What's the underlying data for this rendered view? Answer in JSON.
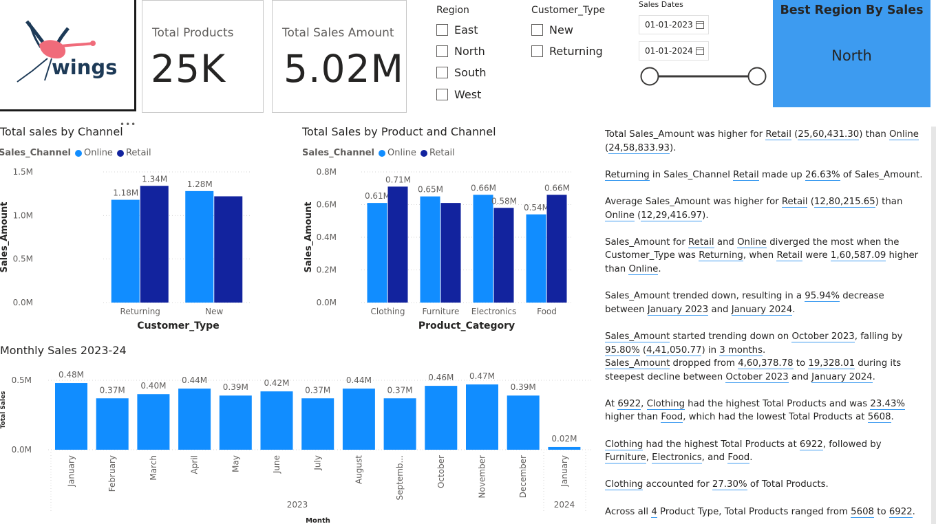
{
  "logo": {
    "text": "wings"
  },
  "cards": [
    {
      "label": "Total Products",
      "value": "25K"
    },
    {
      "label": "Total Sales Amount",
      "value": "5.02M"
    }
  ],
  "region_slicer": {
    "title": "Region",
    "options": [
      "East",
      "North",
      "South",
      "West"
    ]
  },
  "customer_slicer": {
    "title": "Customer_Type",
    "options": [
      "New",
      "Returning"
    ]
  },
  "date_slicer": {
    "title": "Sales Dates",
    "start": "01-01-2023",
    "end": "01-01-2024"
  },
  "best_region": {
    "title": "Best Region By Sales",
    "value": "North"
  },
  "colors": {
    "online": "#118dff",
    "retail": "#12239e",
    "best_bg": "#3d9bf0"
  },
  "chart_by_channel": {
    "title": "Total sales by Channel",
    "legend_title": "Sales_Channel",
    "xlabel": "Customer_Type",
    "ylabel": "Sales_Amount",
    "more_icon": "•••"
  },
  "chart_by_product": {
    "title": "Total Sales by Product and Channel",
    "legend_title": "Sales_Channel",
    "xlabel": "Product_Category",
    "ylabel": "Sales_Amount"
  },
  "chart_monthly": {
    "title": "Monthly Sales 2023-24",
    "xlabel": "Month",
    "ylabel": "Total Sales",
    "year_labels": [
      "2023",
      "2024"
    ]
  },
  "chart_data": [
    {
      "type": "bar",
      "title": "Total sales by Channel",
      "categories": [
        "Returning",
        "New"
      ],
      "series": [
        {
          "name": "Online",
          "values": [
            1180000,
            1280000
          ],
          "labels": [
            "1.18M",
            "1.28M"
          ]
        },
        {
          "name": "Retail",
          "values": [
            1340000,
            1220000
          ],
          "labels": [
            "1.34M",
            ""
          ]
        }
      ],
      "yticks": [
        "0.0M",
        "0.5M",
        "1.0M",
        "1.5M"
      ],
      "ylim": [
        0,
        1500000
      ],
      "xlabel": "Customer_Type",
      "ylabel": "Sales_Amount",
      "legend": "top-left",
      "grid": true
    },
    {
      "type": "bar",
      "title": "Total Sales by Product and Channel",
      "categories": [
        "Clothing",
        "Furniture",
        "Electronics",
        "Food"
      ],
      "series": [
        {
          "name": "Online",
          "values": [
            610000,
            650000,
            660000,
            540000
          ],
          "labels": [
            "0.61M",
            "0.65M",
            "0.66M",
            "0.54M"
          ]
        },
        {
          "name": "Retail",
          "values": [
            710000,
            610000,
            580000,
            660000
          ],
          "labels": [
            "0.71M",
            "",
            "0.58M",
            "0.66M"
          ]
        }
      ],
      "yticks": [
        "0.0M",
        "0.2M",
        "0.4M",
        "0.6M",
        "0.8M"
      ],
      "ylim": [
        0,
        800000
      ],
      "xlabel": "Product_Category",
      "ylabel": "Sales_Amount",
      "legend": "top-left",
      "grid": true
    },
    {
      "type": "bar",
      "title": "Monthly Sales 2023-24",
      "categories": [
        "January",
        "February",
        "March",
        "April",
        "May",
        "June",
        "July",
        "August",
        "Septemb...",
        "October",
        "November",
        "December",
        "January"
      ],
      "years": [
        "2023",
        "2023",
        "2023",
        "2023",
        "2023",
        "2023",
        "2023",
        "2023",
        "2023",
        "2023",
        "2023",
        "2023",
        "2024"
      ],
      "values": [
        480000,
        370000,
        400000,
        440000,
        390000,
        420000,
        370000,
        440000,
        370000,
        460000,
        470000,
        390000,
        20000
      ],
      "labels": [
        "0.48M",
        "0.37M",
        "0.40M",
        "0.44M",
        "0.39M",
        "0.42M",
        "0.37M",
        "0.44M",
        "0.37M",
        "0.46M",
        "0.47M",
        "0.39M",
        "0.02M"
      ],
      "yticks": [
        "0.0M",
        "0.5M"
      ],
      "ylim": [
        0,
        500000
      ],
      "xlabel": "Month",
      "ylabel": "Total Sales",
      "grid": true
    }
  ],
  "narrative": [
    [
      {
        "t": "Total Sales_Amount was higher for "
      },
      {
        "t": "Retail",
        "u": 1
      },
      {
        "t": " ("
      },
      {
        "t": "25,60,431.30",
        "u": 1
      },
      {
        "t": ") than "
      },
      {
        "t": "Online",
        "u": 1
      },
      {
        "t": " ("
      },
      {
        "t": "24,58,833.93",
        "u": 1
      },
      {
        "t": ")."
      }
    ],
    [
      {
        "t": "Returning",
        "u": 1
      },
      {
        "t": " in Sales_Channel "
      },
      {
        "t": "Retail",
        "u": 1
      },
      {
        "t": " made up "
      },
      {
        "t": "26.63%",
        "u": 1
      },
      {
        "t": " of Sales_Amount."
      }
    ],
    [
      {
        "t": "Average Sales_Amount was higher for "
      },
      {
        "t": "Retail",
        "u": 1
      },
      {
        "t": " ("
      },
      {
        "t": "12,80,215.65",
        "u": 1
      },
      {
        "t": ") than "
      },
      {
        "t": "Online",
        "u": 1
      },
      {
        "t": " ("
      },
      {
        "t": "12,29,416.97",
        "u": 1
      },
      {
        "t": ")."
      }
    ],
    [
      {
        "t": "Sales_Amount for "
      },
      {
        "t": "Retail",
        "u": 1
      },
      {
        "t": " and "
      },
      {
        "t": "Online",
        "u": 1
      },
      {
        "t": " diverged the most when the Customer_Type was "
      },
      {
        "t": "Returning",
        "u": 1
      },
      {
        "t": ", when "
      },
      {
        "t": "Retail",
        "u": 1
      },
      {
        "t": " were "
      },
      {
        "t": "1,60,587.09",
        "u": 1
      },
      {
        "t": " higher than "
      },
      {
        "t": "Online",
        "u": 1
      },
      {
        "t": "."
      }
    ],
    [
      {
        "t": "Sales_Amount trended down, resulting in a "
      },
      {
        "t": "95.94%",
        "u": 1
      },
      {
        "t": " decrease between "
      },
      {
        "t": "January 2023",
        "u": 1
      },
      {
        "t": " and "
      },
      {
        "t": "January 2024",
        "u": 1
      },
      {
        "t": "."
      }
    ],
    [
      {
        "t": "Sales_Amount",
        "u": 1
      },
      {
        "t": " started trending down on "
      },
      {
        "t": "October 2023",
        "u": 1
      },
      {
        "t": ", falling by "
      },
      {
        "t": "95.80%",
        "u": 1
      },
      {
        "t": " ("
      },
      {
        "t": "4,41,050.77",
        "u": 1
      },
      {
        "t": ") in "
      },
      {
        "t": "3 months",
        "u": 1
      },
      {
        "t": "."
      }
    ],
    [
      {
        "t": "Sales_Amount",
        "u": 1
      },
      {
        "t": " dropped from "
      },
      {
        "t": "4,60,378.78",
        "u": 1
      },
      {
        "t": " to "
      },
      {
        "t": "19,328.01",
        "u": 1
      },
      {
        "t": " during its steepest decline between "
      },
      {
        "t": "October 2023",
        "u": 1
      },
      {
        "t": " and "
      },
      {
        "t": "January 2024",
        "u": 1
      },
      {
        "t": "."
      }
    ],
    [
      {
        "t": "At "
      },
      {
        "t": "6922",
        "u": 1
      },
      {
        "t": ", "
      },
      {
        "t": "Clothing",
        "u": 1
      },
      {
        "t": " had the highest Total Products and was "
      },
      {
        "t": "23.43%",
        "u": 1
      },
      {
        "t": " higher than "
      },
      {
        "t": "Food",
        "u": 1
      },
      {
        "t": ", which had the lowest Total Products at "
      },
      {
        "t": "5608",
        "u": 1
      },
      {
        "t": "."
      }
    ],
    [
      {
        "t": "Clothing",
        "u": 1
      },
      {
        "t": " had the highest Total Products at "
      },
      {
        "t": "6922",
        "u": 1
      },
      {
        "t": ", followed by "
      },
      {
        "t": "Furniture",
        "u": 1
      },
      {
        "t": ", "
      },
      {
        "t": "Electronics",
        "u": 1
      },
      {
        "t": ", and "
      },
      {
        "t": "Food",
        "u": 1
      },
      {
        "t": "."
      }
    ],
    [
      {
        "t": "Clothing",
        "u": 1
      },
      {
        "t": " accounted for "
      },
      {
        "t": "27.30%",
        "u": 1
      },
      {
        "t": " of Total Products."
      }
    ],
    [
      {
        "t": "Across all "
      },
      {
        "t": "4",
        "u": 1
      },
      {
        "t": " Product Type, Total Products ranged from "
      },
      {
        "t": "5608",
        "u": 1
      },
      {
        "t": " to "
      },
      {
        "t": "6922",
        "u": 1
      },
      {
        "t": "."
      }
    ]
  ]
}
